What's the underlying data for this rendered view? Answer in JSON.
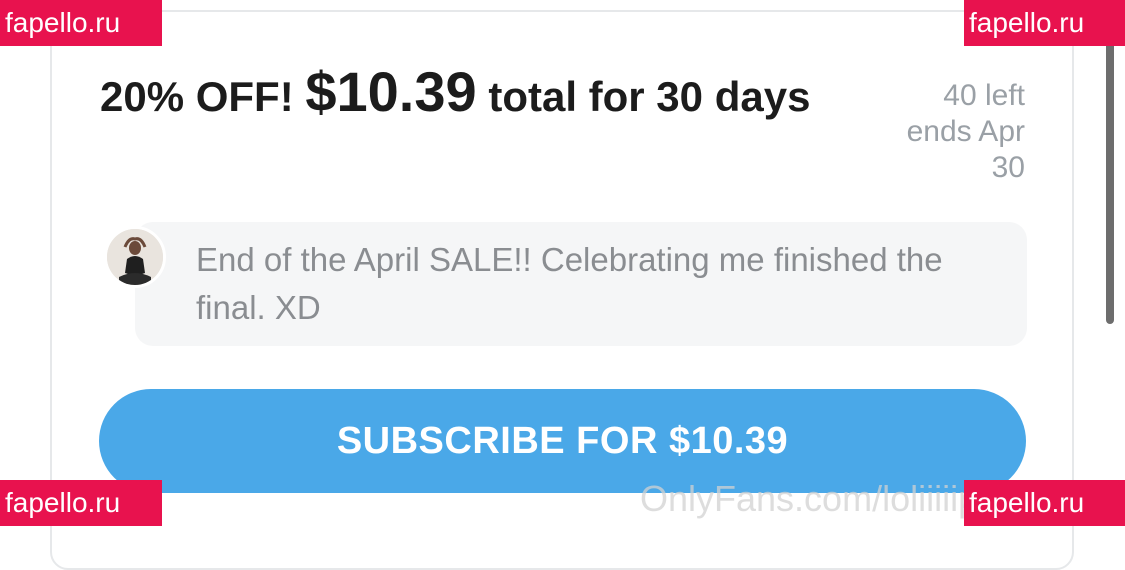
{
  "offer": {
    "prefix": "20% OFF!",
    "price": "$10.39",
    "suffix": "total for 30 days",
    "remaining": "40 left",
    "ends_line1": "ends Apr",
    "ends_line2": "30"
  },
  "message": {
    "text": "End of the April SALE!! Celebrating me finished the final. XD"
  },
  "subscribe_button": {
    "label": "SUBSCRIBE FOR $10.39",
    "color": "#4aa8e8"
  },
  "watermarks": {
    "site": "fapello.ru",
    "site_color": "#e8124e",
    "onlyfans": "OnlyFans.com/loliiiiip"
  }
}
